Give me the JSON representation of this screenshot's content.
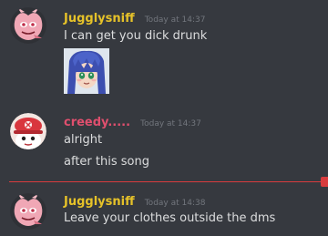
{
  "messages": [
    {
      "username": "Jugglysniff",
      "username_color": "#e6c229",
      "timestamp": "Today at 14:37",
      "lines": [
        "I can get you dick drunk"
      ],
      "has_image": true
    },
    {
      "username": "creedy.....",
      "username_color": "#e04f6e",
      "timestamp": "Today at 14:37",
      "lines": [
        "alright",
        "after this song"
      ]
    },
    {
      "username": "Jugglysniff",
      "username_color": "#e6c229",
      "timestamp": "Today at 14:38",
      "lines": [
        "Leave your clothes outside the dms"
      ]
    }
  ],
  "colors": {
    "background": "#36393f",
    "text": "#dcddde",
    "timestamp": "#72767d",
    "new_messages_divider": "#d83c3e"
  },
  "icons": {
    "avatar_1": "pink-demon-avatar-icon",
    "avatar_2": "red-hat-character-avatar-icon",
    "attachment": "anime-girl-image-icon"
  }
}
